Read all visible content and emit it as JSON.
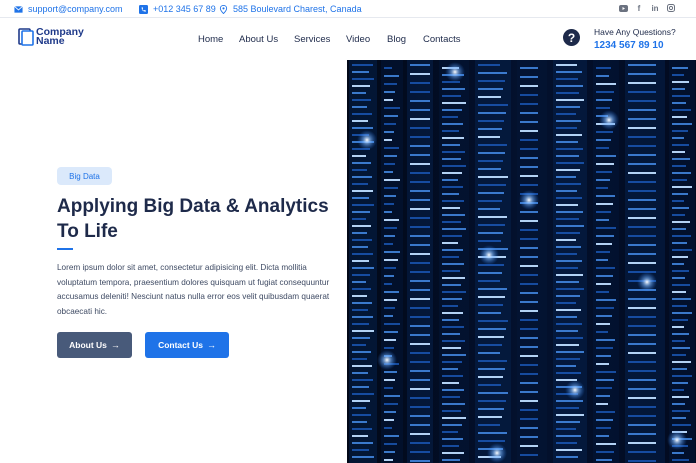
{
  "topbar": {
    "email": "support@company.com",
    "phone": "+012 345 67 89",
    "address": "585 Boulevard Charest, Canada",
    "socials": [
      "youtube-icon",
      "facebook-icon",
      "linkedin-icon",
      "instagram-icon"
    ]
  },
  "header": {
    "logo_line1": "Company",
    "logo_line2": "Name",
    "nav": [
      "Home",
      "About Us",
      "Services",
      "Video",
      "Blog",
      "Contacts"
    ],
    "question_title": "Have Any Questions?",
    "question_phone": "1234 567 89 10"
  },
  "hero": {
    "badge": "Big Data",
    "title": "Applying Big Data & Analytics To Life",
    "text": "Lorem ipsum dolor sit amet, consectetur adipisicing elit. Dicta mollitia voluptatum tempora, praesentium dolores quisquam ut fugiat consequuntur accusamus deleniti! Nesciunt natus nulla error eos velit quibusdam quaerat obcaecati hic.",
    "about_button": "About Us",
    "contact_button": "Contact Us",
    "arrow": "→",
    "image_alt": "server-racks-image"
  },
  "colors": {
    "accent": "#1f73e8",
    "dark": "#1e2a4a",
    "slate_button": "#485a7a",
    "badge_bg": "#dbe9fb"
  }
}
